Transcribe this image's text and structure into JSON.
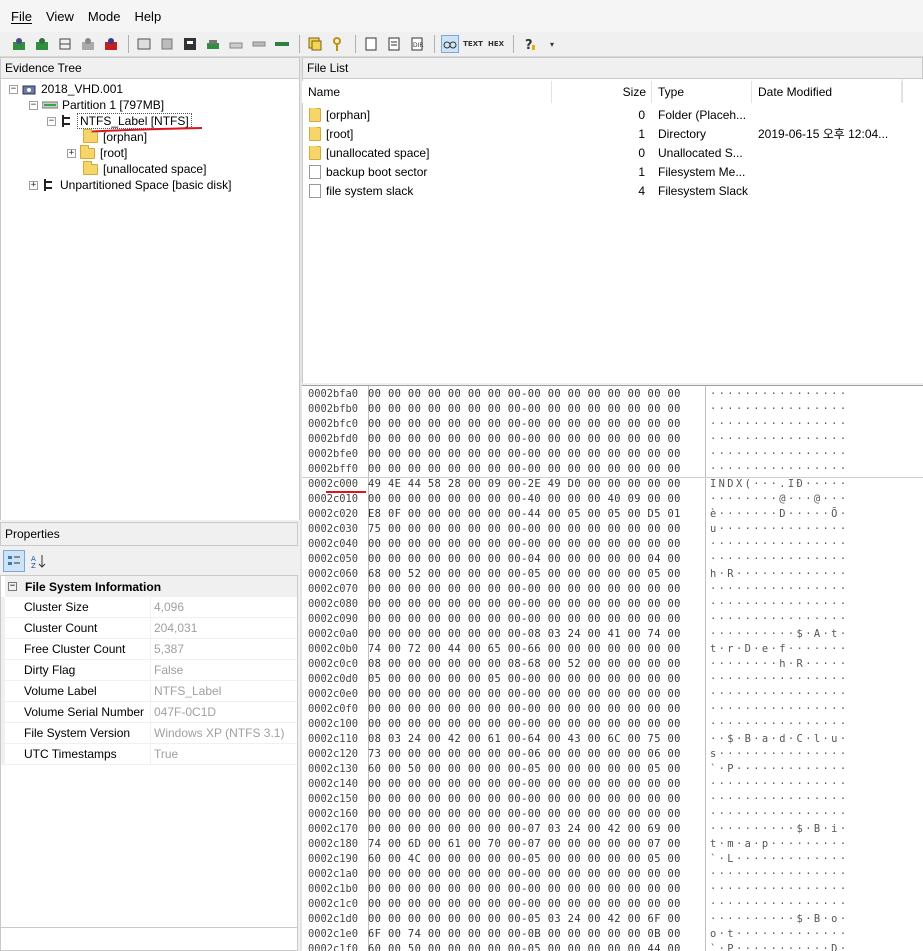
{
  "menu": {
    "file": "File",
    "view": "View",
    "mode": "Mode",
    "help": "Help"
  },
  "toolbar": {
    "icons": [
      "add-evidence-icon",
      "add-all-evidence-icon",
      "image-mounting-icon",
      "remove-evidence-icon",
      "remove-all-evidence-icon",
      "create-disk-image-icon",
      "export-files-icon",
      "obtain-protected-files-icon",
      "capture-memory-icon",
      "verify-drive-icon",
      "decrypt-apfs-icon",
      "export-directory-listing-icon",
      "add-to-custom-content-icon",
      "add-to-custom-content-image-icon",
      "create-custom-content-image-icon",
      "create-image-icon",
      "hex-view-active-icon",
      "text-view-icon",
      "hex-view-icon",
      "help-icon"
    ],
    "text_label": "TEXT",
    "hex_label": "HEX"
  },
  "evidence_tree": {
    "title": "Evidence Tree",
    "root": "2018_VHD.001",
    "partition": "Partition 1 [797MB]",
    "volume": "NTFS_Label [NTFS]",
    "orphan": "[orphan]",
    "root_dir": "[root]",
    "unalloc": "[unallocated space]",
    "unpartitioned": "Unpartitioned Space [basic disk]"
  },
  "file_list": {
    "title": "File List",
    "columns": {
      "name": "Name",
      "size": "Size",
      "type": "Type",
      "date": "Date Modified"
    },
    "rows": [
      {
        "name": "[orphan]",
        "size": "0",
        "type": "Folder (Placeh...",
        "date": ""
      },
      {
        "name": "[root]",
        "size": "1",
        "type": "Directory",
        "date": "2019-06-15 오후 12:04..."
      },
      {
        "name": "[unallocated space]",
        "size": "0",
        "type": "Unallocated S...",
        "date": ""
      },
      {
        "name": "backup boot sector",
        "size": "1",
        "type": "Filesystem Me...",
        "date": ""
      },
      {
        "name": "file system slack",
        "size": "4",
        "type": "Filesystem Slack",
        "date": ""
      }
    ]
  },
  "properties": {
    "title": "Properties",
    "section": "File System Information",
    "rows": [
      {
        "name": "Cluster Size",
        "value": "4,096"
      },
      {
        "name": "Cluster Count",
        "value": "204,031"
      },
      {
        "name": "Free Cluster Count",
        "value": "5,387"
      },
      {
        "name": "Dirty Flag",
        "value": "False"
      },
      {
        "name": "Volume Label",
        "value": "NTFS_Label"
      },
      {
        "name": "Volume Serial Number",
        "value": "047F-0C1D"
      },
      {
        "name": "File System Version",
        "value": "Windows XP (NTFS 3.1)"
      },
      {
        "name": "UTC Timestamps",
        "value": "True"
      }
    ]
  },
  "hex": {
    "lines": [
      {
        "off": "0002bfa0",
        "bytes": "00 00 00 00 00 00 00 00-00 00 00 00 00 00 00 00",
        "ascii": "················"
      },
      {
        "off": "0002bfb0",
        "bytes": "00 00 00 00 00 00 00 00-00 00 00 00 00 00 00 00",
        "ascii": "················"
      },
      {
        "off": "0002bfc0",
        "bytes": "00 00 00 00 00 00 00 00-00 00 00 00 00 00 00 00",
        "ascii": "················"
      },
      {
        "off": "0002bfd0",
        "bytes": "00 00 00 00 00 00 00 00-00 00 00 00 00 00 00 00",
        "ascii": "················"
      },
      {
        "off": "0002bfe0",
        "bytes": "00 00 00 00 00 00 00 00-00 00 00 00 00 00 00 00",
        "ascii": "················"
      },
      {
        "off": "0002bff0",
        "bytes": "00 00 00 00 00 00 00 00-00 00 00 00 00 00 00 00",
        "ascii": "················"
      },
      {
        "off": "0002c000",
        "bytes": "49 4E 44 58 28 00 09 00-2E 49 D0 00 00 00 00 00",
        "ascii": "INDX(···.IÐ·····"
      },
      {
        "off": "0002c010",
        "bytes": "00 00 00 00 00 00 00 00-40 00 00 00 40 09 00 00",
        "ascii": "········@···@···"
      },
      {
        "off": "0002c020",
        "bytes": "E8 0F 00 00 00 00 00 00-44 00 05 00 05 00 D5 01",
        "ascii": "è·······D·····Õ·"
      },
      {
        "off": "0002c030",
        "bytes": "75 00 00 00 00 00 00 00-00 00 00 00 00 00 00 00",
        "ascii": "u···············"
      },
      {
        "off": "0002c040",
        "bytes": "00 00 00 00 00 00 00 00-00 00 00 00 00 00 00 00",
        "ascii": "················"
      },
      {
        "off": "0002c050",
        "bytes": "00 00 00 00 00 00 00 00-04 00 00 00 00 00 04 00",
        "ascii": "················"
      },
      {
        "off": "0002c060",
        "bytes": "68 00 52 00 00 00 00 00-05 00 00 00 00 00 05 00",
        "ascii": "h·R·············"
      },
      {
        "off": "0002c070",
        "bytes": "00 00 00 00 00 00 00 00-00 00 00 00 00 00 00 00",
        "ascii": "················"
      },
      {
        "off": "0002c080",
        "bytes": "00 00 00 00 00 00 00 00-00 00 00 00 00 00 00 00",
        "ascii": "················"
      },
      {
        "off": "0002c090",
        "bytes": "00 00 00 00 00 00 00 00-00 00 00 00 00 00 00 00",
        "ascii": "················"
      },
      {
        "off": "0002c0a0",
        "bytes": "00 00 00 00 00 00 00 00-08 03 24 00 41 00 74 00",
        "ascii": "··········$·A·t·"
      },
      {
        "off": "0002c0b0",
        "bytes": "74 00 72 00 44 00 65 00-66 00 00 00 00 00 00 00",
        "ascii": "t·r·D·e·f·······"
      },
      {
        "off": "0002c0c0",
        "bytes": "08 00 00 00 00 00 00 08-68 00 52 00 00 00 00 00",
        "ascii": "········h·R·····"
      },
      {
        "off": "0002c0d0",
        "bytes": "05 00 00 00 00 00 05 00-00 00 00 00 00 00 00 00",
        "ascii": "················"
      },
      {
        "off": "0002c0e0",
        "bytes": "00 00 00 00 00 00 00 00-00 00 00 00 00 00 00 00",
        "ascii": "················"
      },
      {
        "off": "0002c0f0",
        "bytes": "00 00 00 00 00 00 00 00-00 00 00 00 00 00 00 00",
        "ascii": "················"
      },
      {
        "off": "0002c100",
        "bytes": "00 00 00 00 00 00 00 00-00 00 00 00 00 00 00 00",
        "ascii": "················"
      },
      {
        "off": "0002c110",
        "bytes": "08 03 24 00 42 00 61 00-64 00 43 00 6C 00 75 00",
        "ascii": "··$·B·a·d·C·l·u·"
      },
      {
        "off": "0002c120",
        "bytes": "73 00 00 00 00 00 00 00-06 00 00 00 00 00 06 00",
        "ascii": "s···············"
      },
      {
        "off": "0002c130",
        "bytes": "60 00 50 00 00 00 00 00-05 00 00 00 00 00 05 00",
        "ascii": "`·P·············"
      },
      {
        "off": "0002c140",
        "bytes": "00 00 00 00 00 00 00 00-00 00 00 00 00 00 00 00",
        "ascii": "················"
      },
      {
        "off": "0002c150",
        "bytes": "00 00 00 00 00 00 00 00-00 00 00 00 00 00 00 00",
        "ascii": "················"
      },
      {
        "off": "0002c160",
        "bytes": "00 00 00 00 00 00 00 00-00 00 00 00 00 00 00 00",
        "ascii": "················"
      },
      {
        "off": "0002c170",
        "bytes": "00 00 00 00 00 00 00 00-07 03 24 00 42 00 69 00",
        "ascii": "··········$·B·i·"
      },
      {
        "off": "0002c180",
        "bytes": "74 00 6D 00 61 00 70 00-07 00 00 00 00 00 07 00",
        "ascii": "t·m·a·p·········"
      },
      {
        "off": "0002c190",
        "bytes": "60 00 4C 00 00 00 00 00-05 00 00 00 00 00 05 00",
        "ascii": "`·L·············"
      },
      {
        "off": "0002c1a0",
        "bytes": "00 00 00 00 00 00 00 00-00 00 00 00 00 00 00 00",
        "ascii": "················"
      },
      {
        "off": "0002c1b0",
        "bytes": "00 00 00 00 00 00 00 00-00 00 00 00 00 00 00 00",
        "ascii": "················"
      },
      {
        "off": "0002c1c0",
        "bytes": "00 00 00 00 00 00 00 00-00 00 00 00 00 00 00 00",
        "ascii": "················"
      },
      {
        "off": "0002c1d0",
        "bytes": "00 00 00 00 00 00 00 00-05 03 24 00 42 00 6F 00",
        "ascii": "··········$·B·o·"
      },
      {
        "off": "0002c1e0",
        "bytes": "6F 00 74 00 00 00 00 00-0B 00 00 00 00 00 0B 00",
        "ascii": "o·t·············"
      },
      {
        "off": "0002c1f0",
        "bytes": "60 00 50 00 00 00 00 00-05 00 00 00 00 00 44 00",
        "ascii": "`·P···········D·"
      }
    ]
  },
  "colors": {
    "annotation_red": "#e0141e",
    "selection_blue": "#cde4f7"
  }
}
